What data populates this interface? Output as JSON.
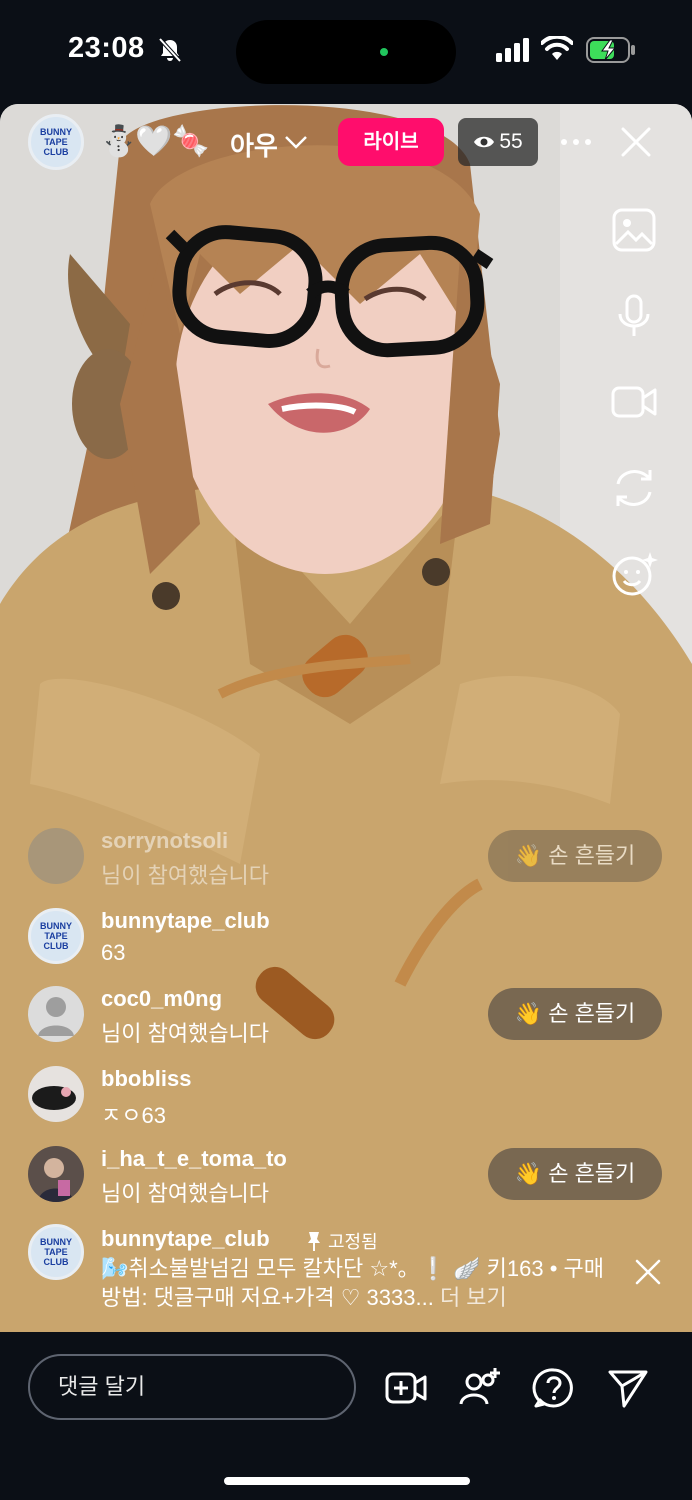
{
  "status_bar": {
    "time": "23:08"
  },
  "header": {
    "host_name": "아우",
    "emojis": [
      "⛄",
      "🤍",
      "🍬"
    ],
    "live_label": "라이브",
    "viewer_count": "55"
  },
  "side_tools": [
    "image-icon",
    "microphone-icon",
    "video-camera-icon",
    "switch-camera-icon",
    "face-effects-icon"
  ],
  "comments": [
    {
      "user": "sorrynotsoli",
      "text": "님이 참여했습니다",
      "wave": "손 흔들기"
    },
    {
      "user": "bunnytape_club",
      "text": "63"
    },
    {
      "user": "coc0_m0ng",
      "text": "님이 참여했습니다",
      "wave": "손 흔들기"
    },
    {
      "user": "bbobliss",
      "text": "ㅈㅇ63"
    },
    {
      "user": "i_ha_t_e_toma_to",
      "text": "님이 참여했습니다",
      "wave": "손 흔들기"
    }
  ],
  "pinned": {
    "user": "bunnytape_club",
    "pinned_label": "고정됨",
    "text": "🌬️취소불발넘김 모두 칼차단 ☆*。❕ 🪽 키163 • 구매방법: 댓글구매 저요+가격 ♡ 3333...",
    "more_label": "더 보기"
  },
  "comment_box": {
    "placeholder": "댓글 달기"
  },
  "avatar_logo": {
    "line1": "BUNNY",
    "line2": "TAPE",
    "line3": "CLUB"
  },
  "colors": {
    "live": "#ff0d6c",
    "background": "#0b0f16",
    "battery": "#3ddc5a"
  }
}
